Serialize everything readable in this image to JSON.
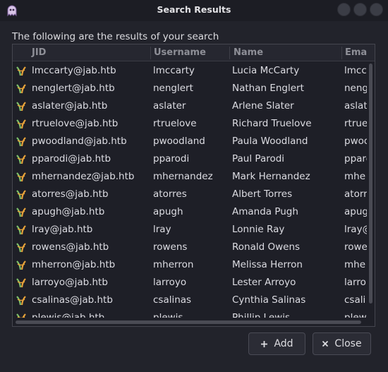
{
  "window": {
    "title": "Search Results"
  },
  "caption": "The following are the results of your search",
  "table": {
    "columns": [
      "JID",
      "Username",
      "Name",
      "Ema"
    ],
    "rows": [
      [
        "lmccarty@jab.htb",
        "lmccarty",
        "Lucia McCarty",
        "lmcca"
      ],
      [
        "nenglert@jab.htb",
        "nenglert",
        "Nathan Englert",
        "nengl"
      ],
      [
        "aslater@jab.htb",
        "aslater",
        "Arlene Slater",
        "aslate"
      ],
      [
        "rtruelove@jab.htb",
        "rtruelove",
        "Richard Truelove",
        "rtruel"
      ],
      [
        "pwoodland@jab.htb",
        "pwoodland",
        "Paula Woodland",
        "pwoo"
      ],
      [
        "pparodi@jab.htb",
        "pparodi",
        "Paul Parodi",
        "ppard"
      ],
      [
        "mhernandez@jab.htb",
        "mhernandez",
        "Mark Hernandez",
        "mhe"
      ],
      [
        "atorres@jab.htb",
        "atorres",
        "Albert Torres",
        "atorr"
      ],
      [
        "apugh@jab.htb",
        "apugh",
        "Amanda Pugh",
        "apug"
      ],
      [
        "lray@jab.htb",
        "lray",
        "Lonnie Ray",
        "lray@"
      ],
      [
        "rowens@jab.htb",
        "rowens",
        "Ronald Owens",
        "rowe"
      ],
      [
        "mherron@jab.htb",
        "mherron",
        "Melissa Herron",
        "mhe"
      ],
      [
        "larroyo@jab.htb",
        "larroyo",
        "Lester Arroyo",
        "larro"
      ],
      [
        "csalinas@jab.htb",
        "csalinas",
        "Cynthia Salinas",
        "csali"
      ],
      [
        "plewis@jab.htb",
        "plewis",
        "Phillip Lewis",
        "plew"
      ]
    ]
  },
  "buttons": {
    "add": "Add",
    "close": "Close"
  },
  "icons": {
    "app": "ghost-app-icon",
    "row": "jabber-user-icon",
    "add": "plus-icon",
    "close": "x-icon"
  },
  "colors": {
    "background": "#22232b",
    "table_bg": "#1e1f27",
    "icon_green": "#7ec26a",
    "icon_orange": "#e8a33a"
  }
}
